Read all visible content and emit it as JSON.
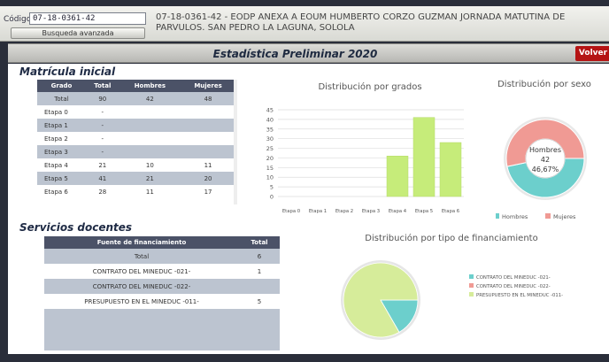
{
  "header": {
    "codigo_label": "Código",
    "codigo_value": "07-18-0361-42",
    "advanced_search_label": "Busqueda avanzada",
    "school_name": "07-18-0361-42 - EODP ANEXA A EOUM HUMBERTO CORZO GUZMAN JORNADA MATUTINA DE PARVULOS. SAN PEDRO LA LAGUNA, SOLOLA"
  },
  "title_bar": {
    "title": "Estadística Preliminar 2020",
    "back_label": "Volver"
  },
  "matricula": {
    "title": "Matrícula inicial",
    "columns": [
      "Grado",
      "Total",
      "Hombres",
      "Mujeres"
    ],
    "rows": [
      {
        "grado": "Total",
        "total": "90",
        "hombres": "42",
        "mujeres": "48"
      },
      {
        "grado": "Etapa 0",
        "total": "-",
        "hombres": "",
        "mujeres": ""
      },
      {
        "grado": "Etapa 1",
        "total": "-",
        "hombres": "",
        "mujeres": ""
      },
      {
        "grado": "Etapa 2",
        "total": "-",
        "hombres": "",
        "mujeres": ""
      },
      {
        "grado": "Etapa 3",
        "total": "-",
        "hombres": "",
        "mujeres": ""
      },
      {
        "grado": "Etapa 4",
        "total": "21",
        "hombres": "10",
        "mujeres": "11"
      },
      {
        "grado": "Etapa 5",
        "total": "41",
        "hombres": "21",
        "mujeres": "20"
      },
      {
        "grado": "Etapa 6",
        "total": "28",
        "hombres": "11",
        "mujeres": "17"
      }
    ]
  },
  "servicios": {
    "title": "Servicios docentes",
    "columns": [
      "Fuente de financiamiento",
      "Total"
    ],
    "rows": [
      {
        "fuente": "Total",
        "total": "6"
      },
      {
        "fuente": "CONTRATO DEL MINEDUC -021-",
        "total": "1"
      },
      {
        "fuente": "CONTRATO DEL MINEDUC -022-",
        "total": ""
      },
      {
        "fuente": "PRESUPUESTO EN EL MINEDUC -011-",
        "total": "5"
      }
    ]
  },
  "colors": {
    "bar_fill": "#c6ec7a",
    "hombres": "#6ccfcc",
    "mujeres": "#f09a94",
    "contrato_021": "#6ccfcc",
    "contrato_022": "#f09a94",
    "presupuesto_011": "#d6ec9a",
    "header_dark": "#4b5267",
    "volver": "#b51414"
  },
  "chart_data": [
    {
      "type": "bar",
      "title": "Distribución por grados",
      "categories": [
        "Etapa 0",
        "Etapa 1",
        "Etapa 2",
        "Etapa 3",
        "Etapa 4",
        "Etapa 5",
        "Etapa 6"
      ],
      "values": [
        0,
        0,
        0,
        0,
        21,
        41,
        28
      ],
      "yticks": [
        0,
        5,
        10,
        15,
        20,
        25,
        30,
        35,
        40,
        45
      ],
      "ylim": [
        0,
        45
      ],
      "grid": true
    },
    {
      "type": "pie",
      "title": "Distribución por sexo",
      "labels": [
        "Hombres",
        "Mujeres"
      ],
      "values": [
        42,
        48
      ],
      "center_label": "Hombres",
      "center_value": "42",
      "center_percent": "46,67%",
      "legend": "bottom"
    },
    {
      "type": "pie",
      "title": "Distribución por tipo de financiamiento",
      "labels": [
        "CONTRATO DEL MINEDUC -021-",
        "CONTRATO DEL MINEDUC -022-",
        "PRESUPUESTO EN EL MINEDUC -011-"
      ],
      "values": [
        1,
        0,
        5
      ],
      "legend": "right"
    }
  ]
}
